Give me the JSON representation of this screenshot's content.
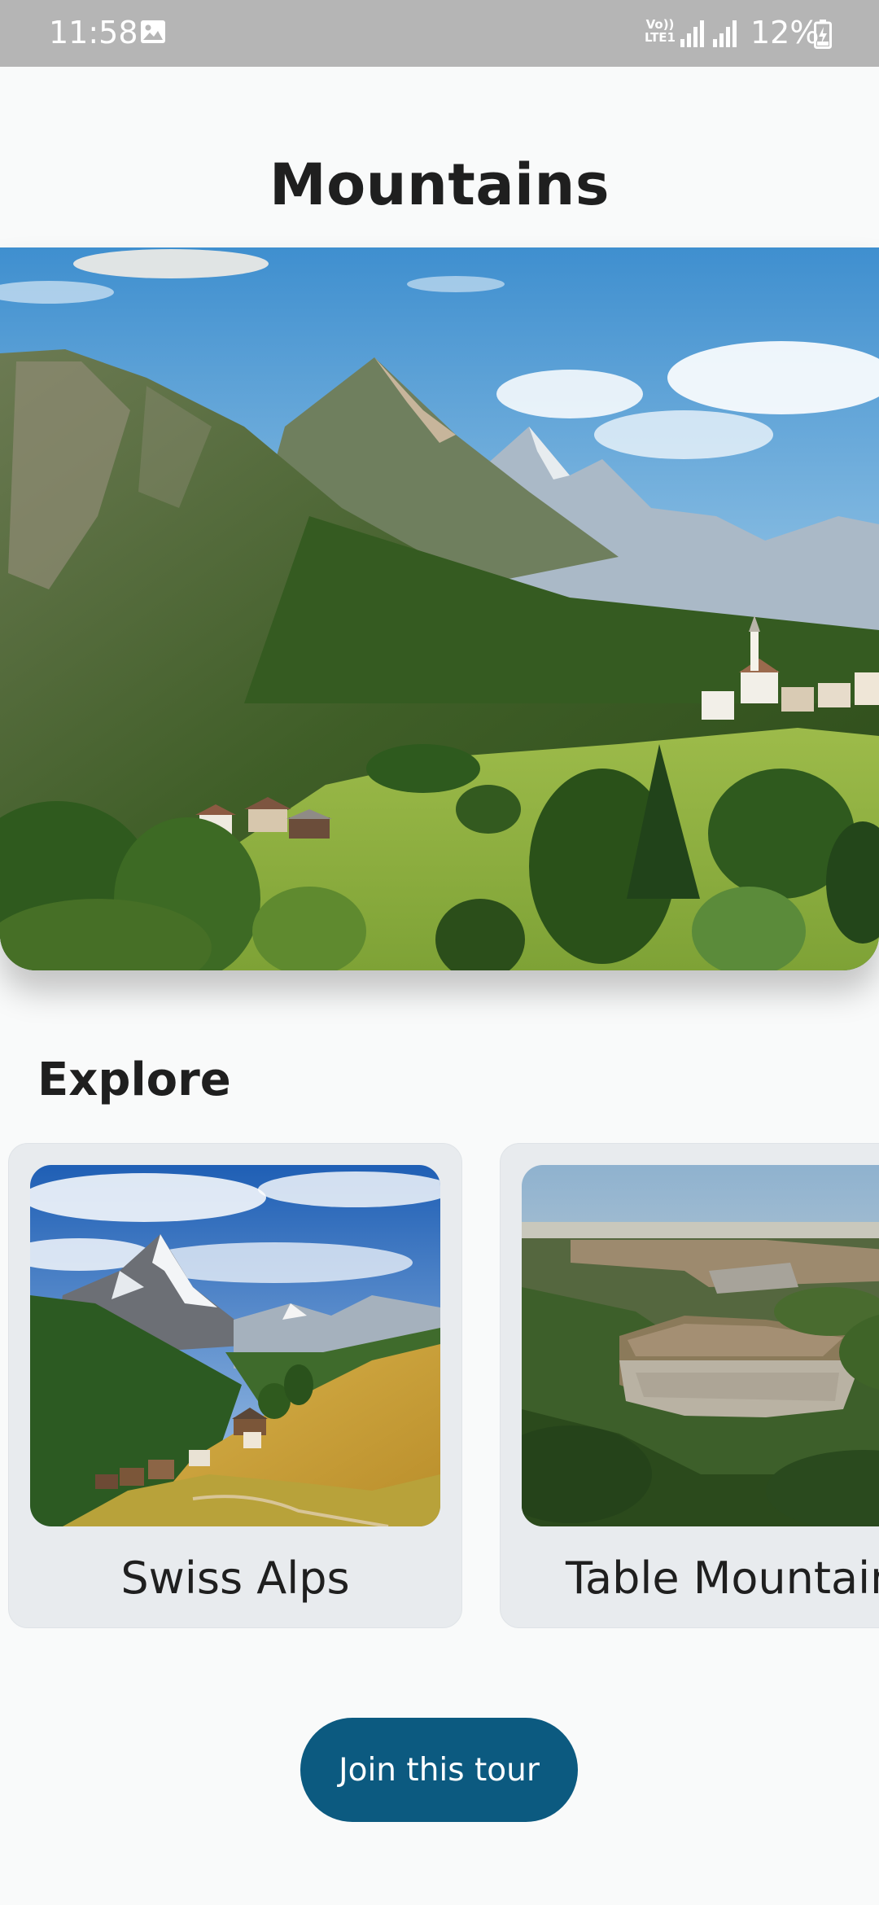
{
  "status_bar": {
    "time": "11:58",
    "network_label_top": "Vo))",
    "network_label_bottom": "LTE1",
    "battery_percent": "12%",
    "icons": [
      "gallery-icon",
      "signal-icon",
      "signal-icon",
      "battery-charging-icon"
    ]
  },
  "page": {
    "title": "Mountains"
  },
  "hero": {
    "image_alt": "Alpine valley with village and peaks"
  },
  "explore": {
    "heading": "Explore",
    "cards": [
      {
        "label": "Swiss Alps"
      },
      {
        "label": "Table Mountain"
      }
    ]
  },
  "cta": {
    "label": "Join this tour"
  },
  "colors": {
    "background": "#f9fafa",
    "status_bar": "#b5b5b5",
    "card_bg": "#e8ebee",
    "button_bg": "#0c5a80",
    "button_text": "#ffffff",
    "text": "#1f1f1f"
  }
}
